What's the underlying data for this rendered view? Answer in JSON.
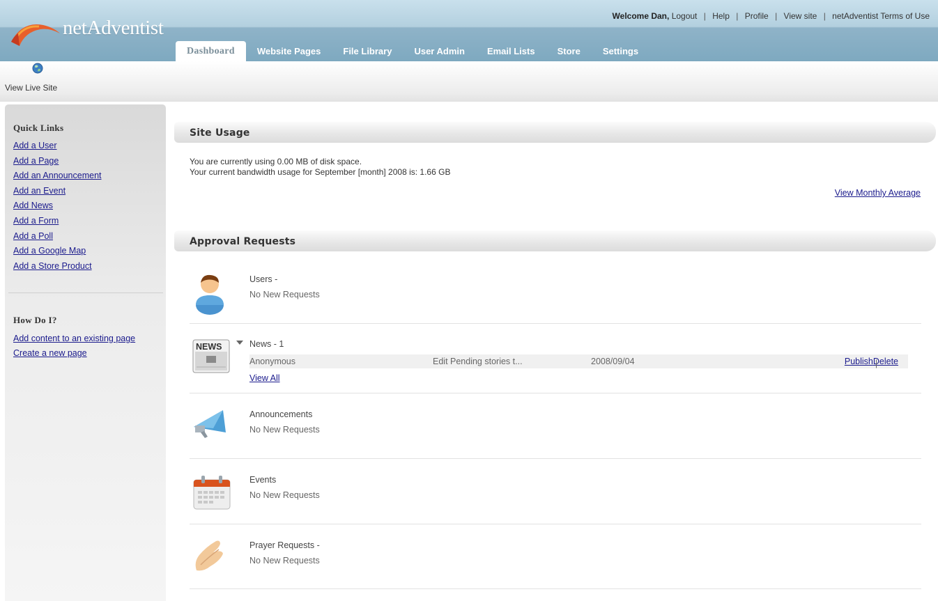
{
  "header": {
    "logo_text": "netAdventist",
    "welcome": "Welcome Dan,",
    "links": [
      "Logout",
      "Help",
      "Profile",
      "View site",
      "netAdventist Terms of Use"
    ]
  },
  "tabs": [
    {
      "label": "Dashboard",
      "active": true
    },
    {
      "label": "Website Pages"
    },
    {
      "label": "File Library"
    },
    {
      "label": "User Admin"
    },
    {
      "label": "Email Lists"
    },
    {
      "label": "Store"
    },
    {
      "label": "Settings"
    }
  ],
  "toolbar": {
    "live_site_label": "View Live Site",
    "live_site_icon": "globe-icon"
  },
  "sidebar": {
    "quick_links_heading": "Quick Links",
    "quick_links": [
      "Add a User",
      "Add a Page",
      "Add an Announcement",
      "Add an Event",
      "Add News",
      "Add a Form",
      "Add a Poll",
      "Add a Google Map",
      "Add a Store Product"
    ],
    "howdo_heading": "How Do I?",
    "howdo_links": [
      "Add content to an existing page",
      "Create a new page"
    ]
  },
  "site_usage": {
    "title": "Site Usage",
    "line1": "You are currently using 0.00 MB of disk space.",
    "line2": "Your current bandwidth usage for September [month] 2008 is: 1.66 GB",
    "monthly_link": "View Monthly Average"
  },
  "approval": {
    "title": "Approval Requests",
    "users": {
      "label": "Users -",
      "status": "No New Requests",
      "icon": "user-icon"
    },
    "news": {
      "label": "News - 1",
      "icon_text": "NEWS",
      "icon": "newspaper-icon",
      "item": {
        "author": "Anonymous",
        "summary": "Edit Pending stories t...",
        "date": "2008/09/04",
        "publish": "Publish",
        "separator": "|",
        "delete": "Delete"
      },
      "view_all": "View All"
    },
    "announcements": {
      "label": "Announcements",
      "status": "No New Requests",
      "icon": "megaphone-icon"
    },
    "events": {
      "label": "Events",
      "status": "No New Requests",
      "icon": "calendar-icon"
    },
    "prayer": {
      "label": "Prayer Requests -",
      "status": "No New Requests",
      "icon": "praying-hands-icon"
    }
  },
  "colors": {
    "header_blue": "#8fb3c8",
    "link": "#1a1a8c",
    "sidebar_bg": "#e6e6e6"
  }
}
